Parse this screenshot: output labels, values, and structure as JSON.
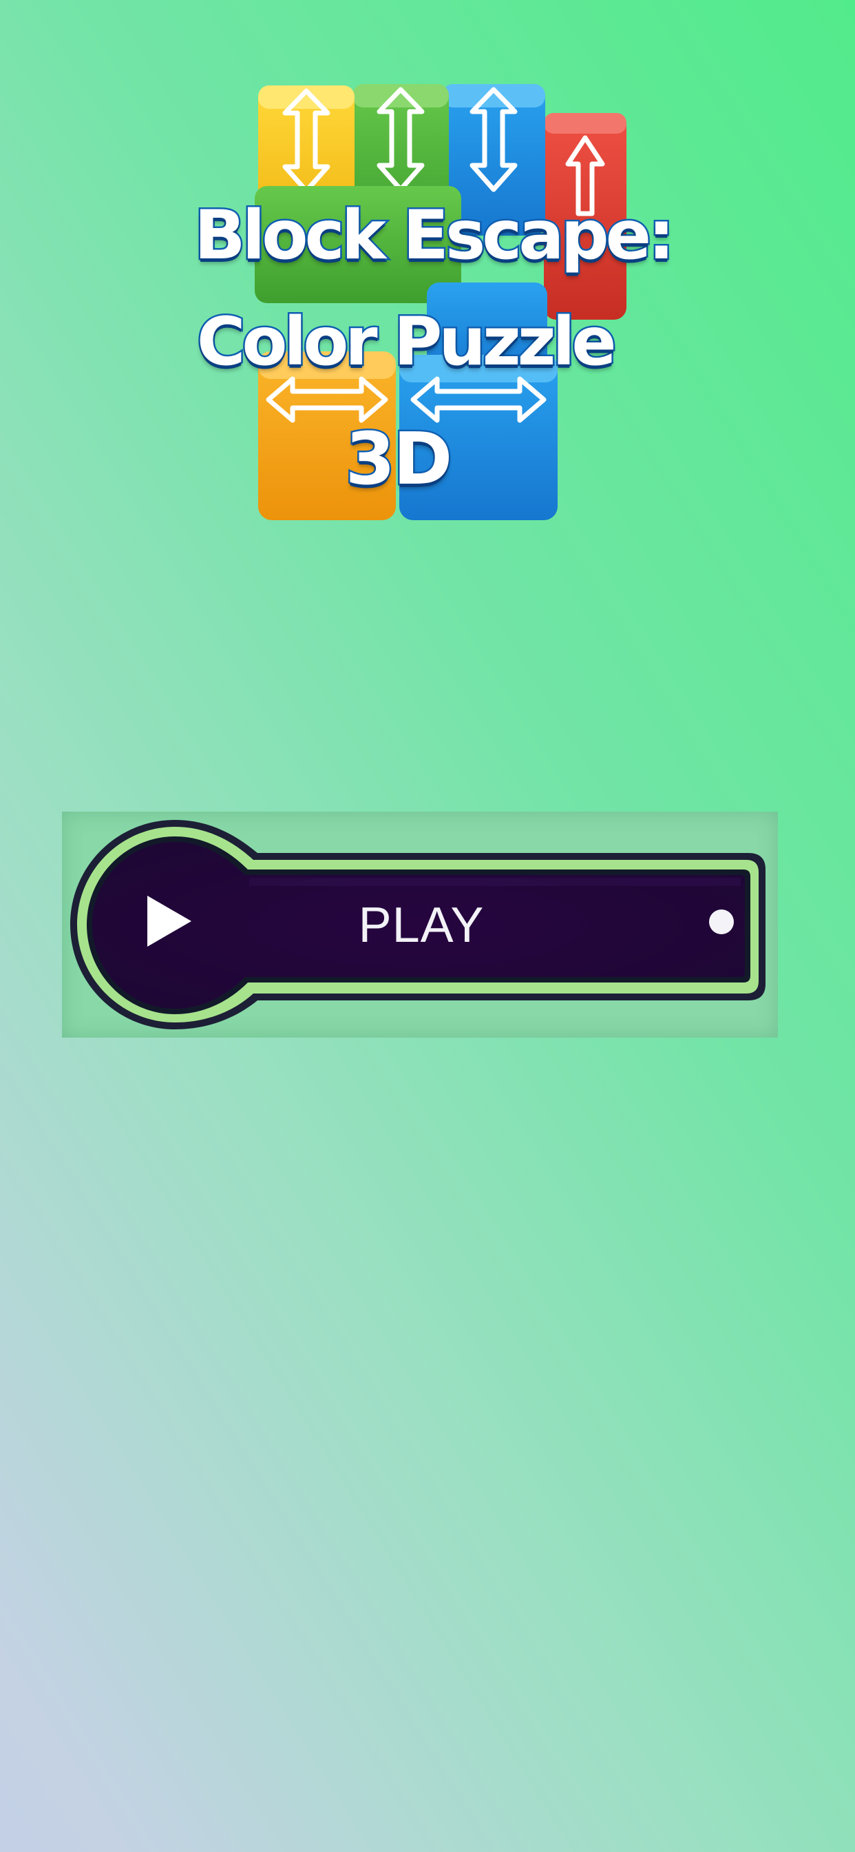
{
  "game": {
    "logo": {
      "line1": "Block Escape:",
      "line2": "Color Puzzle",
      "line3": "3D"
    },
    "play_button": {
      "label": "PLAY",
      "icon": "play-triangle-icon",
      "indicator": "dot-indicator"
    }
  },
  "colors": {
    "background_start": "#c3d0e6",
    "background_end": "#52eb8b",
    "button_fill": "#22063f",
    "button_rim": "#a7e38d",
    "logo_outline": "#0f5fb2",
    "block_yellow": "#f8c41a",
    "block_green": "#4cb53a",
    "block_blue": "#1c8ce0",
    "block_red": "#de3b2f",
    "block_orange": "#f4a114"
  }
}
